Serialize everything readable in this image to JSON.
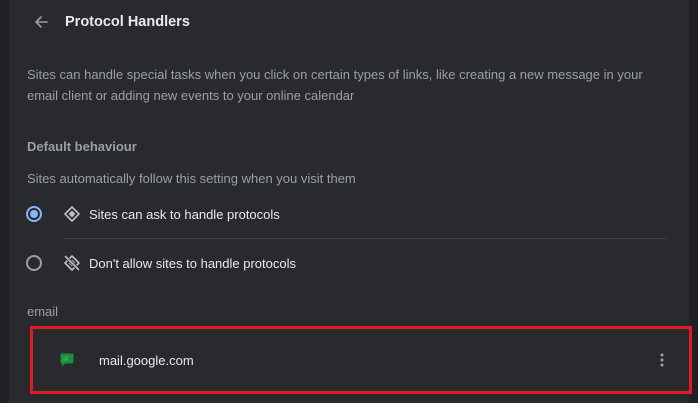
{
  "header": {
    "title": "Protocol Handlers",
    "back_icon": "arrow-left-icon"
  },
  "description": "Sites can handle special tasks when you click on certain types of links, like creating a new message in your email client or adding new events to your online calendar",
  "default_behaviour": {
    "heading": "Default behaviour",
    "subtext": "Sites automatically follow this setting when you visit them",
    "options": [
      {
        "label": "Sites can ask to handle protocols",
        "selected": true,
        "icon": "protocol-handler-icon"
      },
      {
        "label": "Don't allow sites to handle protocols",
        "selected": false,
        "icon": "protocol-handler-off-icon"
      }
    ]
  },
  "email_section": {
    "label": "email",
    "sites": [
      {
        "name": "mail.google.com",
        "icon": "google-chat-icon",
        "menu_icon": "more-vertical-icon"
      }
    ]
  },
  "colors": {
    "background": "#202124",
    "card": "#292a2d",
    "accent": "#8ab4f8",
    "highlight": "#e01b24",
    "site_icon": "#1e8e3e"
  }
}
